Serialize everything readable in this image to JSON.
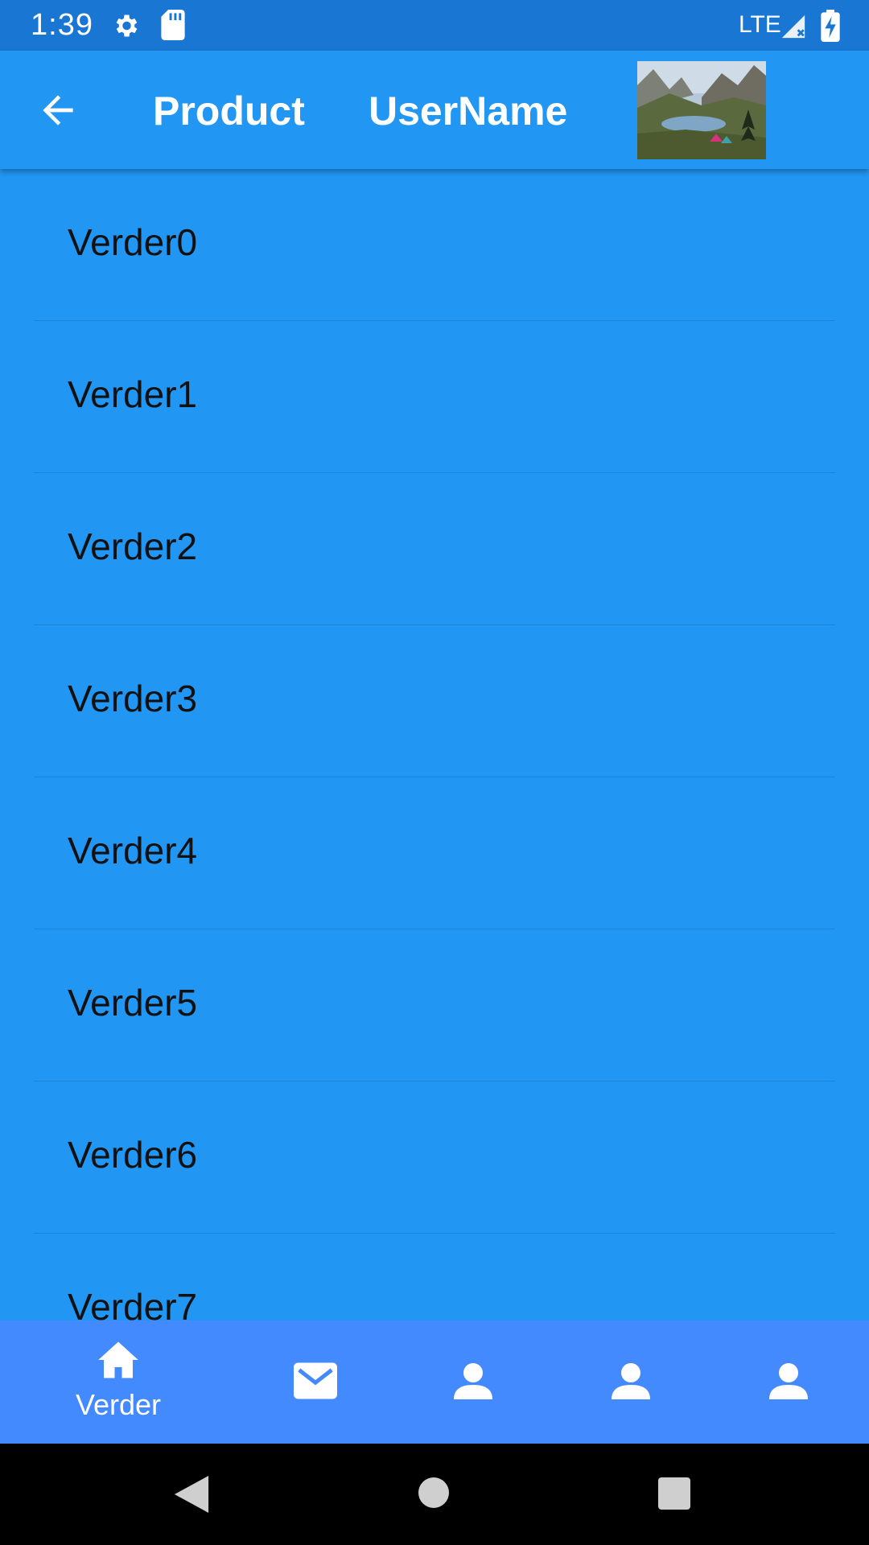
{
  "status_bar": {
    "time": "1:39",
    "network": "LTE",
    "icons": [
      "gear-icon",
      "sd-card-icon",
      "signal-icon",
      "battery-charging-icon"
    ]
  },
  "app_bar": {
    "back_icon": "arrow-back-icon",
    "title": "Product",
    "username": "UserName",
    "image_desc": "mountain-lake-campsite-thumbnail"
  },
  "list": {
    "items": [
      {
        "label": "Verder0"
      },
      {
        "label": "Verder1"
      },
      {
        "label": "Verder2"
      },
      {
        "label": "Verder3"
      },
      {
        "label": "Verder4"
      },
      {
        "label": "Verder5"
      },
      {
        "label": "Verder6"
      },
      {
        "label": "Verder7"
      }
    ]
  },
  "bottom_nav": {
    "items": [
      {
        "icon": "home-icon",
        "label": "Verder",
        "selected": true
      },
      {
        "icon": "mail-icon",
        "label": "",
        "selected": false
      },
      {
        "icon": "person-icon",
        "label": "",
        "selected": false
      },
      {
        "icon": "person-icon",
        "label": "",
        "selected": false
      },
      {
        "icon": "person-icon",
        "label": "",
        "selected": false
      }
    ]
  },
  "system_nav": {
    "icons": [
      "back-triangle-icon",
      "home-circle-icon",
      "recents-square-icon"
    ]
  },
  "colors": {
    "status_bar": "#1976D2",
    "primary": "#2196F3",
    "bottom_nav": "#448AFF",
    "text_dark": "#111111"
  }
}
